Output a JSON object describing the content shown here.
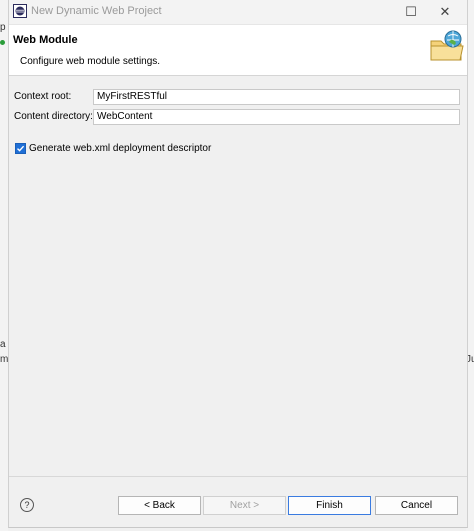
{
  "window": {
    "title": "New Dynamic Web Project",
    "maximize_glyph": "☐",
    "close_glyph": "✕"
  },
  "background": {
    "left_glyphs": [
      "p",
      "a",
      "m"
    ],
    "right_glyphs": [
      "Ju"
    ]
  },
  "header": {
    "title": "Web Module",
    "description": "Configure web module settings.",
    "icon": "wizard-folder-globe-icon"
  },
  "form": {
    "context_root_label": "Context root:",
    "context_root_value": "MyFirstRESTful",
    "content_directory_label": "Content directory:",
    "content_directory_value": "WebContent",
    "generate_xml_label": "Generate web.xml deployment descriptor",
    "generate_xml_checked": true
  },
  "footer": {
    "help_glyph": "?",
    "back_label": "< Back",
    "next_label": "Next >",
    "finish_label": "Finish",
    "cancel_label": "Cancel"
  },
  "colors": {
    "accent": "#1f6fd6",
    "default_button_border": "#3a7be0"
  }
}
